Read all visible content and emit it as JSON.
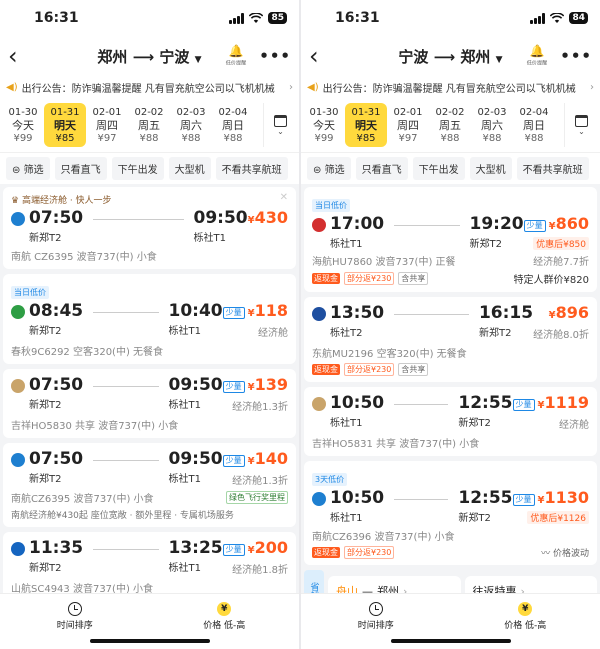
{
  "status": {
    "left_time": "16:31",
    "left_battery": "85",
    "right_time": "16:31",
    "right_battery": "84"
  },
  "colors": {
    "accent": "#ffd93d",
    "price": "#ff5b1e",
    "low": "#1e88e5"
  },
  "common": {
    "notice": "出行公告：防诈骗温馨提醒  凡有冒充航空公司以飞机机械",
    "bell_label": "低价提醒",
    "filters": [
      "筛选",
      "只看直飞",
      "下午出发",
      "大型机",
      "不看共享航班"
    ],
    "sort_time": "时间排序",
    "sort_price": "价格 低-高",
    "class_econ": "经济舱",
    "low_badge": "少量"
  },
  "left": {
    "from": "郑州",
    "to": "宁波",
    "dates": [
      {
        "date": "01-30",
        "week": "今天",
        "price": "¥99"
      },
      {
        "date": "01-31",
        "week": "明天",
        "price": "¥85"
      },
      {
        "date": "02-01",
        "week": "周四",
        "price": "¥97"
      },
      {
        "date": "02-02",
        "week": "周五",
        "price": "¥88"
      },
      {
        "date": "02-03",
        "week": "周六",
        "price": "¥88"
      },
      {
        "date": "02-04",
        "week": "周日",
        "price": "¥88"
      }
    ],
    "flights": [
      {
        "promo": "高端经济舱 · 快人一步",
        "dep": "07:50",
        "dep_apt": "新郑T2",
        "arr": "09:50",
        "arr_apt": "栎社T1",
        "price": "430",
        "meta": "南航 CZ6395  波音737(中)  小食",
        "logo": "#1e7fd0"
      },
      {
        "tag": "当日低价",
        "dep": "08:45",
        "dep_apt": "新郑T2",
        "arr": "10:40",
        "arr_apt": "栎社T1",
        "price": "118",
        "cls": "经济舱",
        "meta": "春秋9C6292  空客320(中)  无餐食",
        "logo": "#2e9e44"
      },
      {
        "dep": "07:50",
        "dep_apt": "新郑T2",
        "arr": "09:50",
        "arr_apt": "栎社T1",
        "price": "139",
        "cls": "经济舱1.3折",
        "meta": "吉祥HO5830 共享  波音737(中)  小食",
        "logo": "#c9a46a"
      },
      {
        "dep": "07:50",
        "dep_apt": "新郑T2",
        "arr": "09:50",
        "arr_apt": "栎社T1",
        "price": "140",
        "cls": "经济舱1.3折",
        "meta": "南航CZ6395  波音737(中)  小食",
        "badge": "绿色飞行奖里程",
        "extra": "南航经济舱¥430起 座位宽敞 · 额外里程 · 专属机场服务",
        "logo": "#1e7fd0"
      },
      {
        "dep": "11:35",
        "dep_apt": "新郑T2",
        "arr": "13:25",
        "arr_apt": "栎社T1",
        "price": "200",
        "cls": "经济舱1.8折",
        "meta": "山航SC4943  波音737(中)  小食",
        "logo": "#1565c0"
      }
    ]
  },
  "right": {
    "from": "宁波",
    "to": "郑州",
    "dates": [
      {
        "date": "01-30",
        "week": "今天",
        "price": "¥99"
      },
      {
        "date": "01-31",
        "week": "明天",
        "price": "¥85"
      },
      {
        "date": "02-01",
        "week": "周四",
        "price": "¥97"
      },
      {
        "date": "02-02",
        "week": "周五",
        "price": "¥88"
      },
      {
        "date": "02-03",
        "week": "周六",
        "price": "¥88"
      },
      {
        "date": "02-04",
        "week": "周日",
        "price": "¥88"
      }
    ],
    "flights": [
      {
        "tag": "当日低价",
        "dep": "17:00",
        "dep_apt": "栎社T1",
        "arr": "19:20",
        "arr_apt": "新郑T2",
        "price": "860",
        "after": "优惠后¥850",
        "cls": "经济舱7.7折",
        "meta": "海航HU7860  波音737(中)  正餐",
        "rebate": "部分返¥230",
        "share": "含共享",
        "special": "特定人群价¥820",
        "logo": "#d32f2f"
      },
      {
        "dep": "13:50",
        "dep_apt": "栎社T2",
        "arr": "16:15",
        "arr_apt": "新郑T2",
        "price": "896",
        "cls": "经济舱8.0折",
        "meta": "东航MU2196  空客320(中)  无餐食",
        "rebate": "部分返¥230",
        "share": "含共享",
        "logo": "#1e4fa0"
      },
      {
        "dep": "10:50",
        "dep_apt": "栎社T1",
        "arr": "12:55",
        "arr_apt": "新郑T2",
        "price": "1119",
        "cls": "经济舱",
        "meta": "吉祥HO5831 共享  波音737(中)  小食",
        "logo": "#c9a46a"
      },
      {
        "tag": "3天低价",
        "dep": "10:50",
        "dep_apt": "栎社T1",
        "arr": "12:55",
        "arr_apt": "新郑T2",
        "price": "1130",
        "after": "优惠后¥1126",
        "meta": "南航CZ6396  波音737(中)  小食",
        "rebate": "部分返¥230",
        "wave": "价格波动",
        "logo": "#1e7fd0"
      }
    ],
    "strip": {
      "badge": "省钱",
      "from": "舟山",
      "to": "郑州",
      "round": "往返特惠"
    }
  }
}
